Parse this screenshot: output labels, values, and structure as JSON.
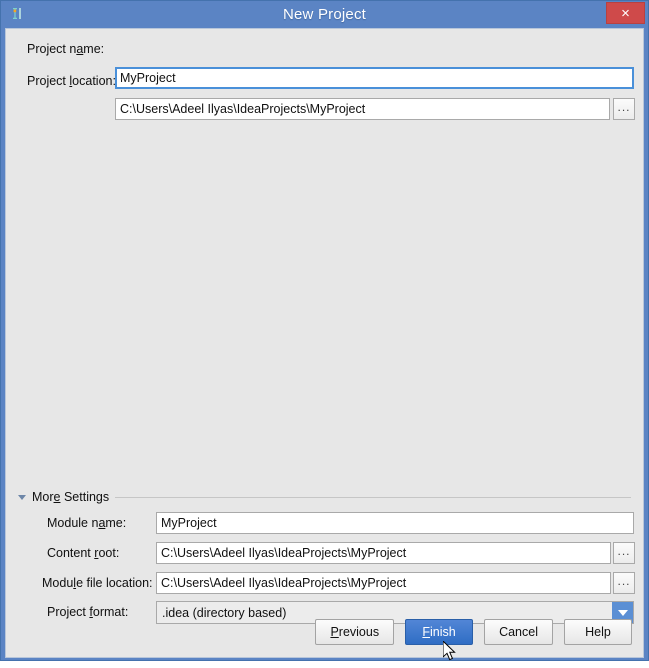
{
  "window": {
    "title": "New Project",
    "app_icon": "intellij-idea-icon",
    "close_label": "×"
  },
  "top_fields": [
    {
      "label_before": "Project n",
      "label_mnemonic": "a",
      "label_after": "me:",
      "value": "MyProject",
      "name": "project-name",
      "focused": true,
      "has_browse": false
    },
    {
      "label_before": "Project ",
      "label_mnemonic": "l",
      "label_after": "ocation:",
      "value": "C:\\Users\\Adeel Ilyas\\IdeaProjects\\MyProject",
      "name": "project-location",
      "focused": false,
      "has_browse": true,
      "browse_label": "..."
    }
  ],
  "more_settings": {
    "label_before": "Mor",
    "label_mnemonic": "e",
    "label_after": " Settings",
    "expanded": true
  },
  "settings_fields": [
    {
      "label_before": "Module n",
      "label_mnemonic": "a",
      "label_after": "me:",
      "value": "MyProject",
      "name": "module-name",
      "has_browse": false
    },
    {
      "label_before": "Content ",
      "label_mnemonic": "r",
      "label_after": "oot:",
      "value": "C:\\Users\\Adeel Ilyas\\IdeaProjects\\MyProject",
      "name": "content-root",
      "has_browse": true,
      "browse_label": "..."
    },
    {
      "label_before": "Modu",
      "label_mnemonic": "l",
      "label_after": "e file location:",
      "value": "C:\\Users\\Adeel Ilyas\\IdeaProjects\\MyProject",
      "name": "module-file-location",
      "has_browse": true,
      "browse_label": "..."
    }
  ],
  "project_format": {
    "label_before": "Project ",
    "label_mnemonic": "f",
    "label_after": "ormat:",
    "selected": ".idea (directory based)"
  },
  "buttons": [
    {
      "before": "",
      "mnemonic": "P",
      "after": "revious",
      "name": "previous-button",
      "primary": false
    },
    {
      "before": "",
      "mnemonic": "F",
      "after": "inish",
      "name": "finish-button",
      "primary": true
    },
    {
      "before": "Cancel",
      "mnemonic": "",
      "after": "",
      "name": "cancel-button",
      "primary": false
    },
    {
      "before": "Help",
      "mnemonic": "",
      "after": "",
      "name": "help-button",
      "primary": false
    }
  ],
  "colors": {
    "titlebar": "#5b84c4",
    "close": "#cf4a4a",
    "dialog_bg": "#e7e7e7",
    "accent": "#3f7cc9",
    "focus_border": "#4a90d9"
  }
}
